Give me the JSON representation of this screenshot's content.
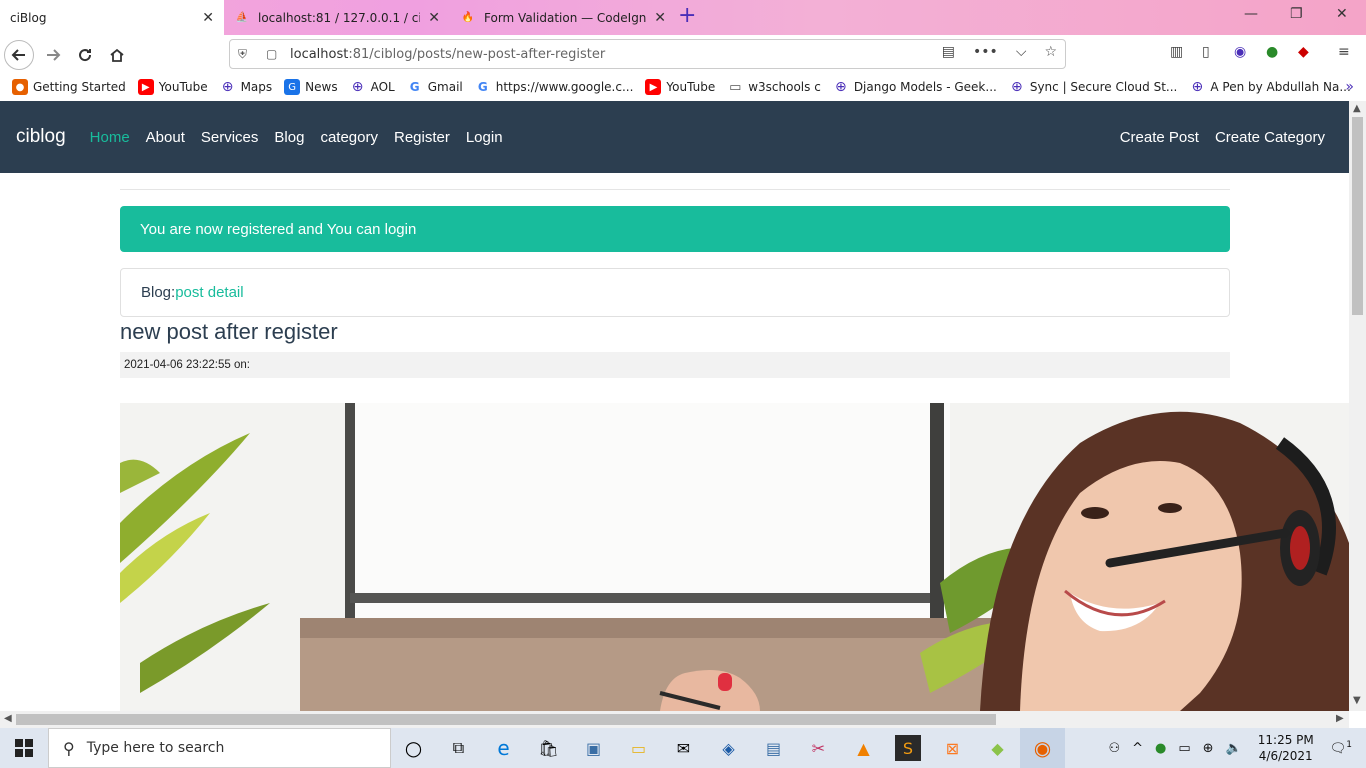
{
  "browser": {
    "tabs": [
      {
        "label": "ciBlog",
        "active": true
      },
      {
        "label": "localhost:81 / 127.0.0.1 / ciblog",
        "icon": "phpmyadmin-icon"
      },
      {
        "label": "Form Validation — CodeIgniter",
        "icon": "codeigniter-icon"
      }
    ],
    "new_tab": "+",
    "url_host": "localhost",
    "url_rest": ":81/ciblog/posts/new-post-after-register",
    "bookmarks": [
      {
        "label": "Getting Started",
        "icon": "firefox-icon",
        "color": "#e66000"
      },
      {
        "label": "YouTube",
        "icon": "youtube-icon",
        "color": "#ff0000"
      },
      {
        "label": "Maps",
        "icon": "globe-icon",
        "color": "#4a2eb8"
      },
      {
        "label": "News",
        "icon": "news-icon",
        "color": "#1a73e8"
      },
      {
        "label": "AOL",
        "icon": "globe-icon",
        "color": "#4a2eb8"
      },
      {
        "label": "Gmail",
        "icon": "google-icon",
        "color": "#4285f4"
      },
      {
        "label": "https://www.google.c...",
        "icon": "google-icon",
        "color": "#4285f4"
      },
      {
        "label": "YouTube",
        "icon": "youtube-icon",
        "color": "#ff0000"
      },
      {
        "label": "w3schools c",
        "icon": "folder-icon",
        "color": "#555"
      },
      {
        "label": "Django Models - Geek...",
        "icon": "globe-icon",
        "color": "#4a2eb8"
      },
      {
        "label": "Sync | Secure Cloud St...",
        "icon": "globe-icon",
        "color": "#4a2eb8"
      },
      {
        "label": "A Pen by Abdullah Na...",
        "icon": "globe-icon",
        "color": "#4a2eb8"
      }
    ]
  },
  "site": {
    "brand": "ciblog",
    "nav_left": [
      "Home",
      "About",
      "Services",
      "Blog",
      "category",
      "Register",
      "Login"
    ],
    "nav_right": [
      "Create Post",
      "Create Category"
    ],
    "accent": "#18bc9c",
    "nav_bg": "#2c3e50"
  },
  "alert": {
    "text": "You are now registered and You can login"
  },
  "breadcrumb": {
    "prefix": "Blog:",
    "link": "post detail"
  },
  "post": {
    "title": "new post after register",
    "meta": "2021-04-06 23:22:55 on:"
  },
  "taskbar": {
    "search_placeholder": "Type here to search",
    "time": "11:25 PM",
    "date": "4/6/2021",
    "notification_count": "1"
  }
}
